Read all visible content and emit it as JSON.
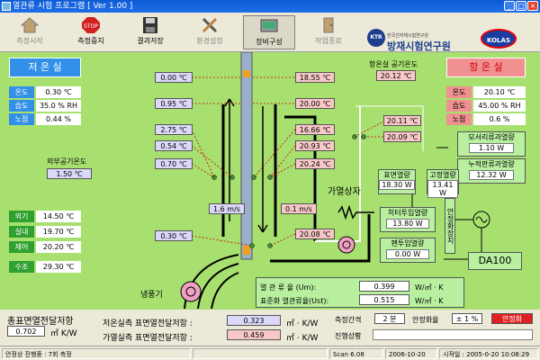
{
  "window": {
    "title": "열관류 시험 프로그램 [ Ver 1.00 ]"
  },
  "toolbar": {
    "buttons": [
      {
        "label": "측정시작"
      },
      {
        "label": "측정중지",
        "icon_text": "STOP"
      },
      {
        "label": "결과저장"
      },
      {
        "label": "환경설정"
      },
      {
        "label": "장비구성"
      },
      {
        "label": "작업종료"
      }
    ],
    "logo_sub": "한국건자재시험연구원",
    "logo_main": "방재시험연구원",
    "logo2_text": "KOLAS"
  },
  "cold": {
    "title": "저 온 실",
    "rows": [
      {
        "label": "온도",
        "value": "0.30 ℃"
      },
      {
        "label": "습도",
        "value": "35.0 % RH"
      },
      {
        "label": "노점",
        "value": "0.44 %"
      }
    ],
    "outside_label": "외부공기온도",
    "outside_value": "1.50 ℃",
    "fan_rows": [
      {
        "label": "외기",
        "value": "14.50 ℃"
      },
      {
        "label": "실내",
        "value": "19.70 ℃"
      },
      {
        "label": "제어",
        "value": "20.20 ℃"
      },
      {
        "label": "수조",
        "value": "29.30 ℃"
      }
    ],
    "fan_label": "냉풍기"
  },
  "hot": {
    "title": "항 온 실",
    "air_label": "항온실 공기온도",
    "air_value": "20.12 ℃",
    "rows": [
      {
        "label": "온도",
        "value": "20.10 ℃"
      },
      {
        "label": "습도",
        "value": "45.00 % RH"
      },
      {
        "label": "노점",
        "value": "0.6 %"
      }
    ]
  },
  "specimen": {
    "left_temps": [
      "0.00 ℃",
      "0.95 ℃",
      "2.75 ℃",
      "0.54 ℃",
      "0.70 ℃",
      "0.30 ℃"
    ],
    "right_top": "18.55 ℃",
    "right_mid": "20.00 ℃",
    "inner_temps": [
      "16.66 ℃",
      "20.93 ℃",
      "20.24 ℃"
    ],
    "right_bottom": "20.08 ℃",
    "wind_left": "1.6 m/s",
    "wind_right": "0.1 m/s",
    "box_temps": [
      "20.11 ℃",
      "20.09 ℃"
    ],
    "box_label": "가열상자"
  },
  "power": {
    "surface_label": "표면열량",
    "surface_value": "18.30 W",
    "fixed_label": "고정열량",
    "fixed_value": "13.41 W",
    "monitor_label": "모서리류과열량",
    "monitor_value": "1.10 W",
    "edge_label": "누적판류과열량",
    "edge_value": "12.32 W",
    "heater_label": "히터투입열량",
    "heater_value": "13.80 W",
    "fan_label": "팬투입열량",
    "fan_value": "0.00 W",
    "ctrl_label": "안정화장치",
    "da_label": "DA100"
  },
  "flux": {
    "row1_label": "열 관 류 율 (Um):",
    "row1_value": "0.399",
    "row1_unit": "W/㎡ · K",
    "row2_label": "표준화 열관류율(Ust):",
    "row2_value": "0.515",
    "row2_unit": "W/㎡ · K"
  },
  "bottom": {
    "total_label": "총표면열전달저항",
    "total_value": "0.702",
    "total_unit": "㎡ K/W",
    "cold_res_label": "저온실측 표면열전달저항 :",
    "cold_res_value": "0.323",
    "cold_res_unit": "㎡ · K/W",
    "hot_res_label": "가열실측 표면열전달저항 :",
    "hot_res_value": "0.459",
    "hot_res_unit": "㎡ · K/W",
    "interval_label": "측정간격",
    "interval_value": "2 분",
    "stable_label": "안정화율",
    "stable_value": "± 1 %",
    "stable_btn": "안정화",
    "state_label": "진행상황"
  },
  "status": {
    "left": "안정상 진행중 : 7회 측정",
    "count": "Scan 6.08",
    "date": "2006-10-20",
    "start": "시작일 : 2005-0-20 10:08:29"
  },
  "colors": {
    "panel": "#a8e070",
    "blue": "#3390e8",
    "pink": "#f09090",
    "lavender": "#dcd8f8"
  }
}
